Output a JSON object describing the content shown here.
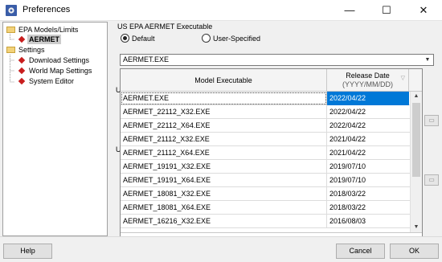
{
  "window": {
    "title": "Preferences",
    "controls": {
      "minimize": "—",
      "maximize": "☐",
      "close": "✕"
    }
  },
  "tree": {
    "items": [
      {
        "label": "EPA Models/Limits",
        "icon": "folder-icon"
      },
      {
        "label": "AERMET",
        "icon": "diamond-icon",
        "selected": true
      },
      {
        "label": "Settings",
        "icon": "folder-icon"
      },
      {
        "label": "Download Settings",
        "icon": "diamond-icon"
      },
      {
        "label": "World Map Settings",
        "icon": "diamond-icon"
      },
      {
        "label": "System Editor",
        "icon": "diamond-icon"
      }
    ]
  },
  "executable_group": {
    "title": "US EPA AERMET Executable",
    "radio_default": {
      "label": "Default",
      "checked": true
    },
    "radio_user": {
      "label": "User-Specified",
      "checked": false
    },
    "selected_value": "AERMET.EXE"
  },
  "background_labels": {
    "second_group_fragment": "U",
    "third_group_fragment": "U"
  },
  "dropdown": {
    "columns": {
      "executable": "Model Executable",
      "release_date": "Release Date",
      "release_date_format": "(YYYY/MM/DD)"
    },
    "rows": [
      {
        "executable": "AERMET.EXE",
        "date": "2022/04/22",
        "selected": true
      },
      {
        "executable": "AERMET_22112_X32.EXE",
        "date": "2022/04/22"
      },
      {
        "executable": "AERMET_22112_X64.EXE",
        "date": "2022/04/22"
      },
      {
        "executable": "AERMET_21112_X32.EXE",
        "date": "2021/04/22"
      },
      {
        "executable": "AERMET_21112_X64.EXE",
        "date": "2021/04/22"
      },
      {
        "executable": "AERMET_19191_X32.EXE",
        "date": "2019/07/10"
      },
      {
        "executable": "AERMET_19191_X64.EXE",
        "date": "2019/07/10"
      },
      {
        "executable": "AERMET_18081_X32.EXE",
        "date": "2018/03/22"
      },
      {
        "executable": "AERMET_18081_X64.EXE",
        "date": "2018/03/22"
      },
      {
        "executable": "AERMET_16216_X32.EXE",
        "date": "2016/08/03"
      }
    ],
    "clear_symbol": "✕",
    "selection_color": "#0078d7"
  },
  "buttons": {
    "help": "Help",
    "cancel": "Cancel",
    "ok": "OK"
  }
}
